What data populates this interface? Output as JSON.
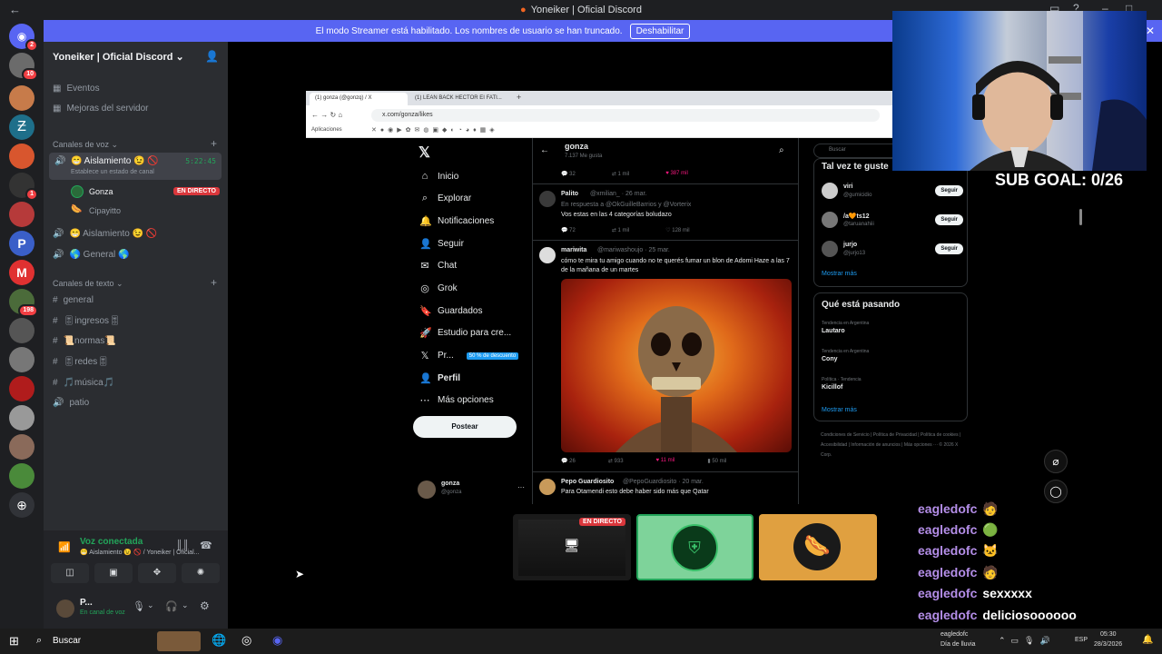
{
  "window": {
    "title": "Yoneiker | Oficial Discord"
  },
  "streamer_banner": {
    "text": "El modo Streamer está habilitado. Los nombres de usuario se han truncado.",
    "button": "Deshabilitar"
  },
  "rail": {
    "badges": [
      "2",
      "10",
      "1",
      "198"
    ]
  },
  "sidebar": {
    "server_name": "Yoneiker | Oficial Discord",
    "top_items": [
      "Eventos",
      "Mejoras del servidor"
    ],
    "voice_category": "Canales de voz",
    "voice_channel_active": "😁 Aislamiento 😉 🚫",
    "voice_channel_status": "Establece un estado de canal",
    "voice_timer": "5:22:45",
    "voice_users": [
      {
        "name": "Gonza",
        "badge": "EN DIRECTO"
      },
      {
        "name": "Cipayitto",
        "badge": ""
      }
    ],
    "voice_channels": [
      "😁 Aislamiento 😉 🚫",
      "🌎 General 🌎"
    ],
    "text_category": "Canales de texto",
    "text_channels": [
      "general",
      "🎚ingresos🎚",
      "📜normas📜",
      "🎚redes🎚",
      "🎵música🎵",
      "patio"
    ]
  },
  "voice_panel": {
    "status": "Voz conectada",
    "detail": "😁 Aislamiento 😉 🚫 / Yoneiker | Oficial...",
    "user_name": "P...",
    "user_status": "En canal de voz"
  },
  "browser": {
    "tab1": "(1) gonza (@gonzq) / X",
    "tab2": "(1) LEAN BACK HECTOR EI FATI...",
    "url": "x.com/gonza/likes",
    "bookmarks_label": "Aplicaciones"
  },
  "x_nav": {
    "items": [
      "Inicio",
      "Explorar",
      "Notificaciones",
      "Seguir",
      "Chat",
      "Grok",
      "Guardados",
      "Estudio para cre...",
      "Pr...",
      "Perfil",
      "Más opciones"
    ],
    "premium_badge": "50 % de descuento",
    "post_button": "Postear",
    "account_name": "gonza",
    "account_handle": "@gonza"
  },
  "x_profile": {
    "name": "gonza",
    "likes": "7.137 Me gusta"
  },
  "tweets": [
    {
      "stats": [
        "32",
        "1 mil",
        "387 mil"
      ]
    },
    {
      "author": "Palito",
      "handle": "@xmilian_ · 26 mar.",
      "reply_to": "En respuesta a @OkGuilleBarrios y @Vorterix",
      "text": "Vos estas en las 4 categorías boludazo",
      "stats": [
        "72",
        "1 mil",
        "128 mil"
      ]
    },
    {
      "author": "mariwita",
      "handle": "@mariwashoujo · 25 mar.",
      "text": "cómo te mira tu amigo cuando no te querés fumar un blon de Adomi Haze a las 7 de la mañana de un martes",
      "stats": [
        "26",
        "933",
        "11 mil",
        "50 mil"
      ]
    },
    {
      "author": "Pepo Guardiosito",
      "handle": "@PepoGuardiosito · 20 mar.",
      "text": "Para Otamendi esto debe haber sido más que Qatar"
    }
  ],
  "right_col": {
    "search": "Buscar",
    "follow_title": "Tal vez te guste",
    "suggestions": [
      {
        "name": "viri",
        "handle": "@gumicidio",
        "btn": "Seguir"
      },
      {
        "name": "/a🧡ts12",
        "handle": "@taruanahiii",
        "btn": "Seguir"
      },
      {
        "name": "jurjo",
        "handle": "@jurjo13",
        "btn": "Seguir"
      }
    ],
    "show_more": "Mostrar más",
    "trends_title": "Qué está pasando",
    "trends": [
      {
        "context": "Tendencia en Argentina",
        "name": "Lautaro"
      },
      {
        "context": "Tendencia en Argentina",
        "name": "Cony"
      },
      {
        "context": "Política · Tendencia",
        "name": "Kicillof"
      }
    ],
    "footer": "Condiciones de Servicio | Política de Privacidad | Política de cookies | Accesibilidad | Información de anuncios | Más opciones ··· © 2026 X Corp."
  },
  "overlay": {
    "sub_goal": "SUB GOAL: 0/26"
  },
  "tiles": {
    "live_badge": "EN DIRECTO"
  },
  "chat": [
    {
      "user": "eagledofc",
      "msg": ""
    },
    {
      "user": "eagledofc",
      "msg": ""
    },
    {
      "user": "eagledofc",
      "msg": ""
    },
    {
      "user": "eagledofc",
      "msg": ""
    },
    {
      "user": "eagledofc",
      "msg": "sexxxxx"
    },
    {
      "user": "eagledofc",
      "msg": "deliciosoooooo"
    },
    {
      "user": "eagledofc",
      "msg": ""
    }
  ],
  "taskbar": {
    "search": "Buscar",
    "weather": "Día de lluvia",
    "lang": "ESP",
    "time": "05:30",
    "date": "28/3/2026"
  },
  "colors": {
    "discord_blurple": "#5865f2",
    "live_red": "#da373c",
    "voice_green": "#23a55a",
    "x_blue": "#1d9bf0",
    "chat_purple": "#b48ee8"
  }
}
